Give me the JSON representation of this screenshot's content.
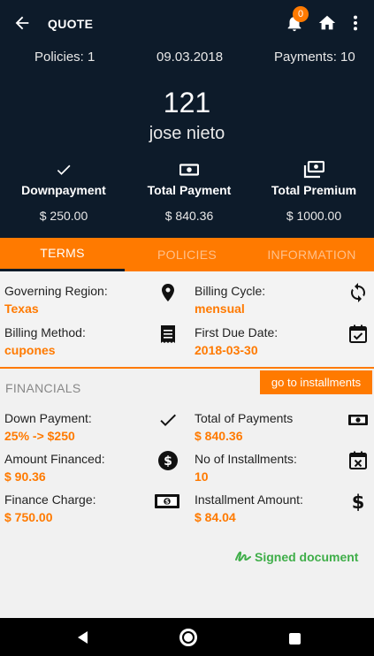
{
  "appbar": {
    "title": "QUOTE",
    "notification_count": "0"
  },
  "meta": {
    "policies": "Policies: 1",
    "date": "09.03.2018",
    "payments": "Payments: 10"
  },
  "client": {
    "number": "121",
    "name": "jose nieto"
  },
  "stats": [
    {
      "label": "Downpayment",
      "value": "$ 250.00"
    },
    {
      "label": "Total Payment",
      "value": "$ 840.36"
    },
    {
      "label": "Total Premium",
      "value": "$ 1000.00"
    }
  ],
  "tabs": [
    "TERMS",
    "POLICIES",
    "INFORMATION"
  ],
  "terms": {
    "governing_region": {
      "label": "Governing Region:",
      "value": "Texas"
    },
    "billing_cycle": {
      "label": "Billing Cycle:",
      "value": "mensual"
    },
    "billing_method": {
      "label": "Billing Method:",
      "value": "cupones"
    },
    "first_due_date": {
      "label": "First Due Date:",
      "value": "2018-03-30"
    }
  },
  "financials": {
    "title": "FINANCIALS",
    "goto_label": "go to installments",
    "down_payment": {
      "label": "Down Payment:",
      "value": "25% -> $250"
    },
    "total_payments": {
      "label": "Total of Payments",
      "value": "$ 840.36"
    },
    "amount_financed": {
      "label": "Amount Financed:",
      "value": "$ 90.36"
    },
    "no_installments": {
      "label": "No of Installments:",
      "value": "10"
    },
    "finance_charge": {
      "label": "Finance Charge:",
      "value": "$ 750.00"
    },
    "installment_amount": {
      "label": "Installment Amount:",
      "value": "$ 84.04"
    }
  },
  "signed": "Signed document",
  "colors": {
    "header_bg": "#0d1b2a",
    "accent": "#ff7a00",
    "signed": "#3fae49"
  },
  "icons": [
    "back-arrow",
    "bell",
    "home",
    "more-vert",
    "check",
    "money",
    "money-stack",
    "map-pin",
    "sync",
    "receipt",
    "calendar-check",
    "dollar-circle",
    "calendar-x",
    "money-bill",
    "dollar",
    "signature"
  ]
}
